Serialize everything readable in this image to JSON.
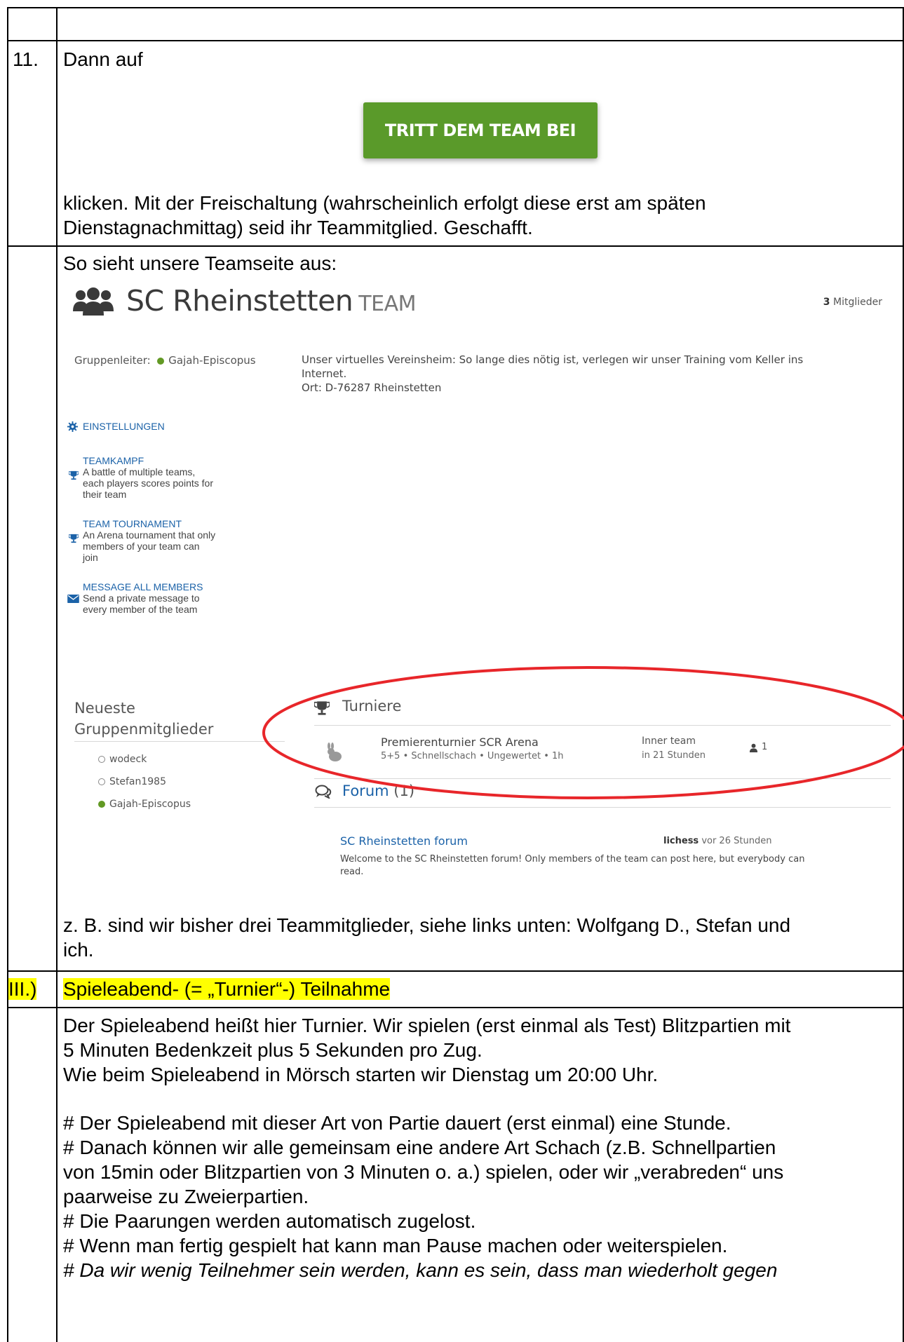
{
  "rows": {
    "r11": {
      "number": "11.",
      "line1": "Dann auf",
      "button": "TRITT DEM TEAM BEI",
      "line2": "klicken. Mit der Freischaltung (wahrscheinlich erfolgt diese erst am späten",
      "line3": "Dienstagnachmittag) seid ihr Teammitglied. Geschafft."
    },
    "screenshot_row": {
      "intro": "So sieht unsere Teamseite aus:",
      "outro1": "z. B. sind wir bisher drei Teammitglieder, siehe links unten: Wolfgang D., Stefan und",
      "outro2": "ich."
    },
    "r3": {
      "number": "III.)",
      "heading": "Spieleabend- (= „Turnier“-) Teilnahme"
    },
    "r3_body": {
      "p1": "Der Spieleabend heißt hier Turnier. Wir spielen (erst einmal als Test) Blitzpartien mit",
      "p2": "5 Minuten Bedenkzeit plus 5 Sekunden pro Zug.",
      "p3": "Wie beim Spieleabend in Mörsch starten wir Dienstag um 20:00 Uhr.",
      "b1": "# Der Spieleabend mit dieser Art von Partie dauert (erst einmal) eine Stunde.",
      "b2a": "# Danach können wir alle gemeinsam eine andere Art Schach (z.B. Schnellpartien",
      "b2b": "von 15min oder Blitzpartien von 3 Minuten o. a.) spielen, oder wir „verabreden“ uns",
      "b2c": "paarweise zu Zweierpartien.",
      "b3": "# Die Paarungen werden automatisch zugelost.",
      "b4": "# Wenn man fertig gespielt hat kann man Pause machen oder weiterspielen.",
      "b5": "# Da wir wenig Teilnehmer sein werden, kann es sein, dass man wiederholt gegen"
    }
  },
  "team_page": {
    "name": "SC Rheinstetten",
    "team_word": "TEAM",
    "members_count": "3",
    "members_label": "Mitglieder",
    "leader_label": "Gruppenleiter:",
    "leader_name": "Gajah-Episcopus",
    "description": [
      "Unser virtuelles Vereinsheim: So lange dies nötig ist, verlegen wir unser Training vom Keller ins",
      "Internet.",
      "Ort: D-76287 Rheinstetten"
    ],
    "settings_label": "EINSTELLUNGEN",
    "tools": [
      {
        "label": "TEAMKAMPF",
        "desc": [
          "A battle of multiple teams,",
          "each players scores points for",
          "their team"
        ],
        "icon": "trophy-icon"
      },
      {
        "label": "TEAM TOURNAMENT",
        "desc": [
          "An Arena tournament that only",
          "members of your team can",
          "join"
        ],
        "icon": "trophy-icon"
      },
      {
        "label": "MESSAGE ALL MEMBERS",
        "desc": [
          "Send a private message to",
          "every member of the team"
        ],
        "icon": "envelope-icon"
      }
    ],
    "newest_title_1": "Neueste",
    "newest_title_2": "Gruppenmitglieder",
    "newest_members": [
      {
        "name": "wodeck",
        "online": false
      },
      {
        "name": "Stefan1985",
        "online": false
      },
      {
        "name": "Gajah-Episcopus",
        "online": true
      }
    ],
    "tournaments_title": "Turniere",
    "tournament": {
      "name": "Premierenturnier SCR Arena",
      "details": "5+5 • Schnellschach • Ungewertet • 1h",
      "type": "Inner team",
      "when": "in 21 Stunden",
      "players": "1"
    },
    "forum_title": "Forum",
    "forum_count": "(1)",
    "forum_post": {
      "title": "SC Rheinstetten forum",
      "author": "lichess",
      "time": "vor 26 Stunden",
      "text": [
        "Welcome to the SC Rheinstetten forum! Only members of the team can post here, but everybody can",
        "read."
      ]
    }
  },
  "colors": {
    "button_green": "#5a9a2a",
    "link_blue": "#1b62a8",
    "online_green": "#629924",
    "annotation_red": "#e8262a",
    "highlight": "#ffff00"
  }
}
